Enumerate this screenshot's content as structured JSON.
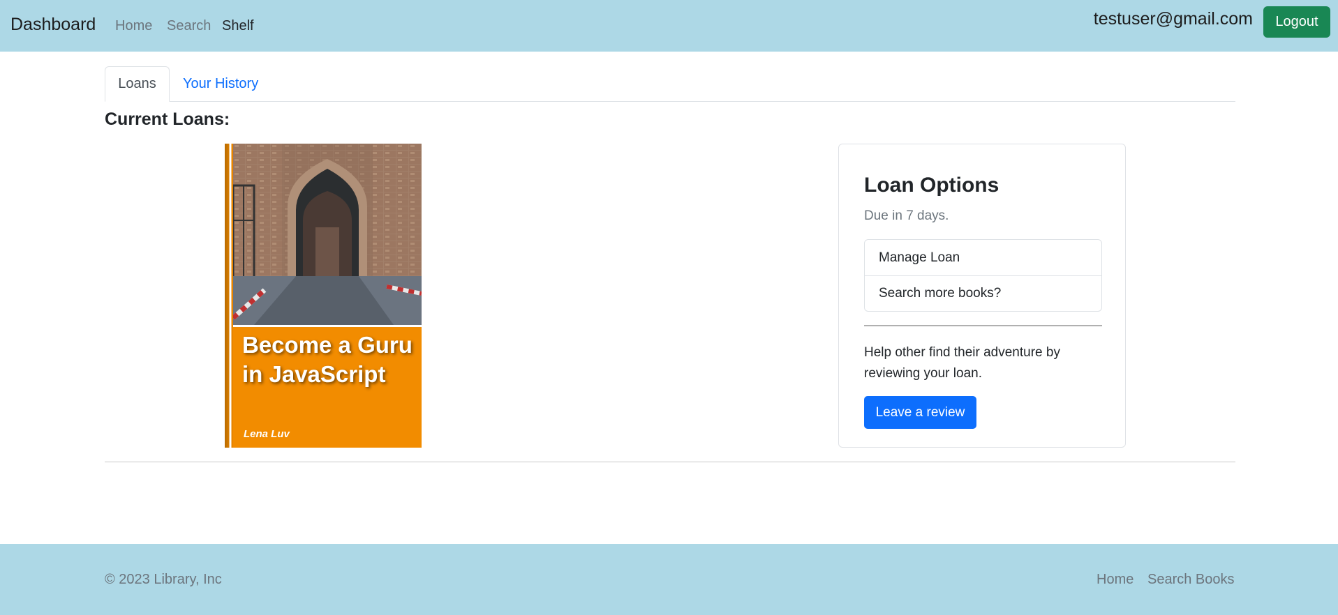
{
  "navbar": {
    "brand": "Dashboard",
    "links": [
      {
        "label": "Home",
        "active": false
      },
      {
        "label": "Search",
        "active": false
      },
      {
        "label": "Shelf",
        "active": true
      }
    ],
    "user_email": "testuser@gmail.com",
    "logout_label": "Logout",
    "background_color": "#add8e6",
    "logout_color": "#198754"
  },
  "tabs": [
    {
      "label": "Loans",
      "active": true
    },
    {
      "label": "Your History",
      "active": false
    }
  ],
  "main": {
    "section_title": "Current Loans:",
    "book": {
      "title": "Become a Guru in JavaScript",
      "author": "Lena Luv",
      "cover_color": "#f28c00"
    },
    "loan_options": {
      "title": "Loan Options",
      "due_text": "Due in 7 days.",
      "menu_items": [
        "Manage Loan",
        "Search more books?"
      ],
      "review_prompt": "Help other find their adventure by reviewing your loan.",
      "review_button": "Leave a review",
      "button_color": "#0d6efd"
    }
  },
  "footer": {
    "copyright": "© 2023 Library, Inc",
    "links": [
      "Home",
      "Search Books"
    ]
  }
}
